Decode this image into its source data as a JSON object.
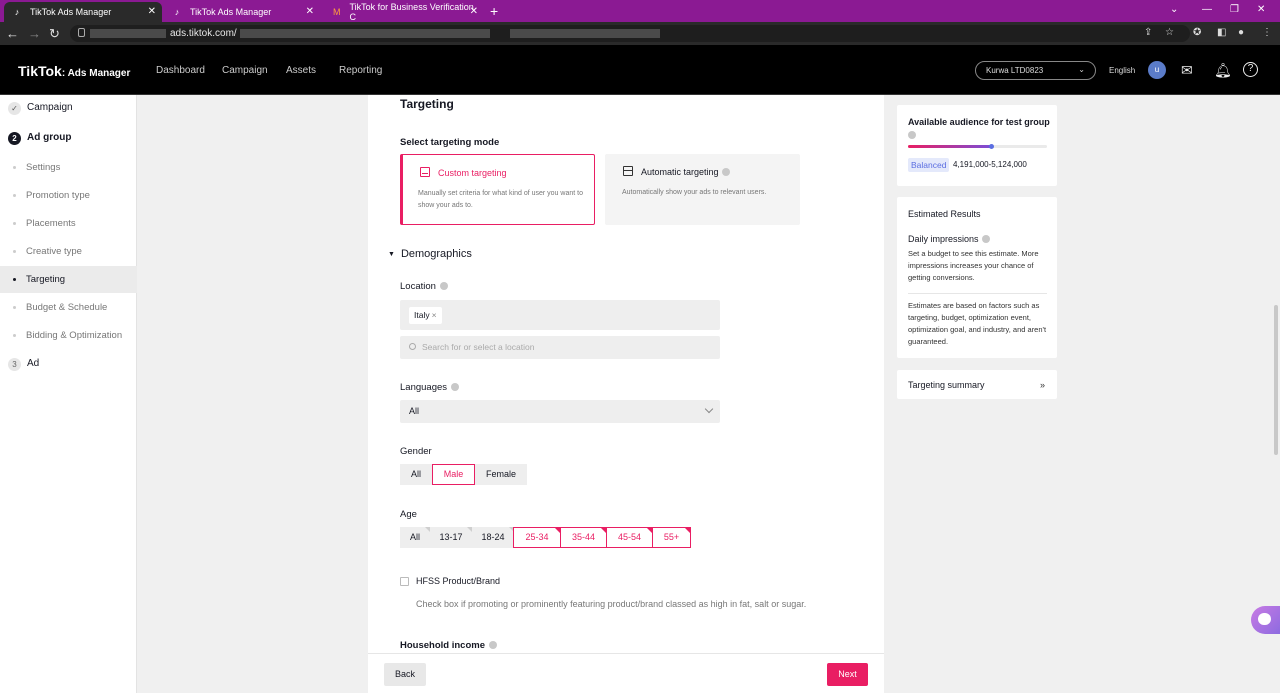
{
  "browser": {
    "tabs": [
      {
        "title": "TikTok Ads Manager",
        "active": true
      },
      {
        "title": "TikTok Ads Manager",
        "active": false
      },
      {
        "title": "TikTok for Business Verification C",
        "active": false
      }
    ],
    "new_tab": "+",
    "url": "ads.tiktok.com/"
  },
  "header": {
    "logo": "TikTok",
    "logo_sub": ": Ads Manager",
    "nav": [
      "Dashboard",
      "Campaign",
      "Assets",
      "Reporting"
    ],
    "account": "Kurwa LTD0823",
    "language": "English",
    "avatar_initial": "u"
  },
  "sidebar": {
    "steps": [
      {
        "number": "✓",
        "label": "Campaign",
        "state": "done"
      },
      {
        "number": "2",
        "label": "Ad group",
        "state": "current"
      },
      {
        "number": "3",
        "label": "Ad",
        "state": "todo"
      }
    ],
    "ad_group_items": [
      {
        "label": "Settings",
        "active": false
      },
      {
        "label": "Promotion type",
        "active": false
      },
      {
        "label": "Placements",
        "active": false
      },
      {
        "label": "Creative type",
        "active": false
      },
      {
        "label": "Targeting",
        "active": true
      },
      {
        "label": "Budget & Schedule",
        "active": false
      },
      {
        "label": "Bidding & Optimization",
        "active": false
      }
    ]
  },
  "targeting": {
    "title": "Targeting",
    "mode_label": "Select targeting mode",
    "modes": [
      {
        "title": "Custom targeting",
        "desc": "Manually set criteria for what kind of user you want to show your ads to.",
        "selected": true
      },
      {
        "title": "Automatic targeting",
        "desc": "Automatically show your ads to relevant users.",
        "selected": false
      }
    ],
    "demographics_label": "Demographics",
    "location": {
      "label": "Location",
      "chips": [
        "Italy"
      ],
      "search_placeholder": "Search for or select a location"
    },
    "languages": {
      "label": "Languages",
      "value": "All"
    },
    "gender": {
      "label": "Gender",
      "options": [
        "All",
        "Male",
        "Female"
      ],
      "selected": "Male"
    },
    "age": {
      "label": "Age",
      "options": [
        "All",
        "13-17",
        "18-24",
        "25-34",
        "35-44",
        "45-54",
        "55+"
      ],
      "selected": [
        "25-34",
        "35-44",
        "45-54",
        "55+"
      ]
    },
    "hfss": {
      "label": "HFSS Product/Brand",
      "help": "Check box if promoting or prominently featuring product/brand classed as high in fat, salt or sugar.",
      "checked": false
    },
    "household_income_label": "Household income"
  },
  "footer": {
    "back": "Back",
    "next": "Next"
  },
  "right_panel": {
    "audience": {
      "title": "Available audience for test group",
      "level_fraction": 0.6,
      "badge": "Balanced",
      "range": "4,191,000-5,124,000"
    },
    "estimated": {
      "title": "Estimated Results",
      "daily_label": "Daily impressions",
      "daily_text": "Set a budget to see this estimate. More impressions increases your chance of getting conversions.",
      "note": "Estimates are based on factors such as targeting, budget, optimization event, optimization goal, and industry, and aren't guaranteed."
    },
    "summary": {
      "title": "Targeting summary"
    }
  },
  "colors": {
    "accent": "#e91e63",
    "browser_frame": "#8b1a93",
    "header_bg": "#000000",
    "balanced_badge": "#5b6ee1"
  },
  "icons": [
    "tiktok-favicon",
    "close-icon",
    "back-icon",
    "forward-icon",
    "reload-icon",
    "lock-icon",
    "share-icon",
    "star-icon",
    "extension-icon",
    "sidebar-icon",
    "profile-icon",
    "menu-icon",
    "chevron-down-icon",
    "inbox-icon",
    "bell-icon",
    "help-icon",
    "check-icon",
    "info-icon",
    "search-icon",
    "chat-icon"
  ]
}
